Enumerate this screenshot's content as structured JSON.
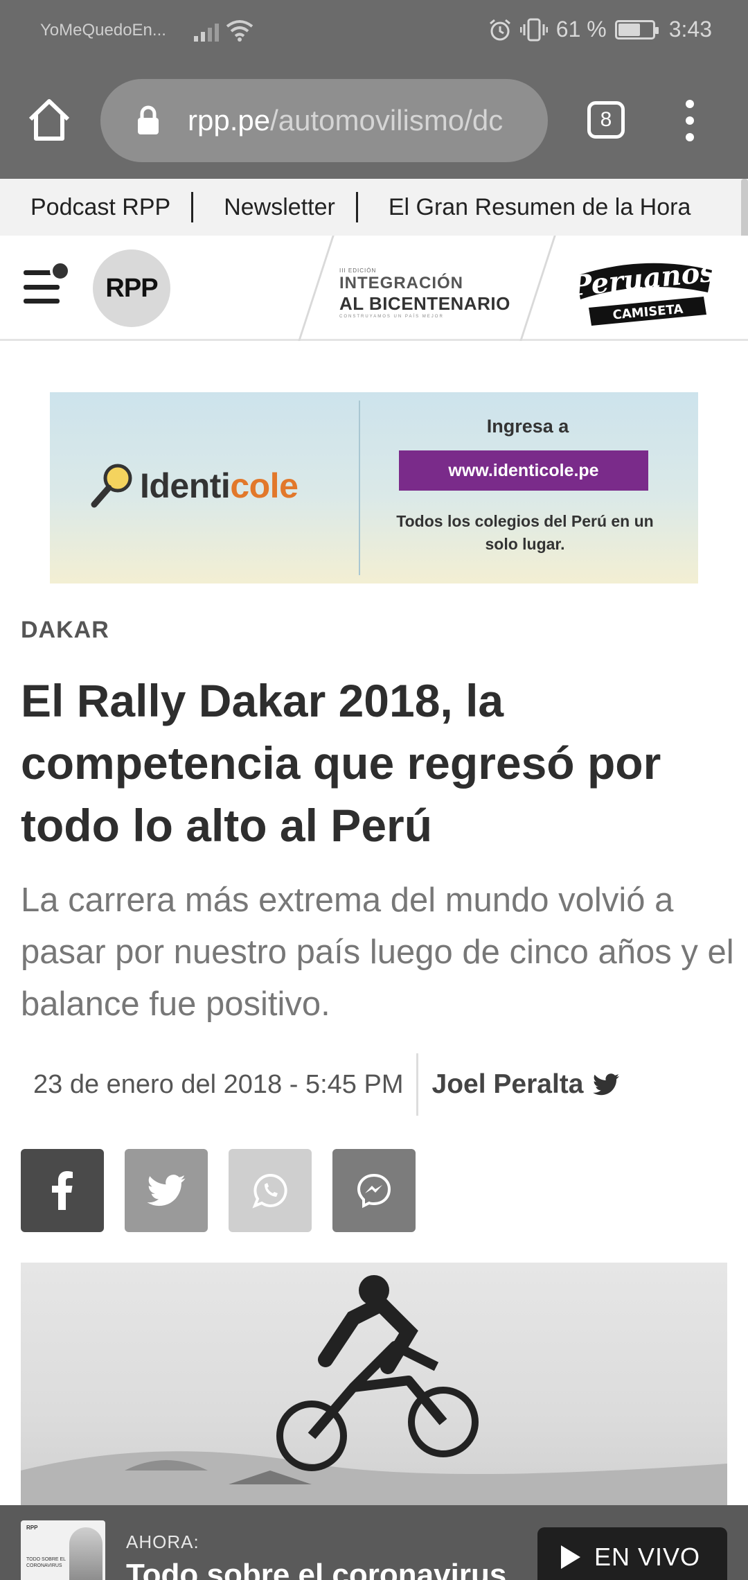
{
  "status_bar": {
    "carrier": "YoMeQuedoEn...",
    "battery": "61 %",
    "battery_level": 0.61,
    "time": "3:43"
  },
  "browser": {
    "url_domain": "rpp.pe",
    "url_path": "/automovilismo/dc",
    "tab_count": "8"
  },
  "top_links": [
    "Podcast RPP",
    "Newsletter",
    "El Gran Resumen de la Hora"
  ],
  "header": {
    "logo": "RPP",
    "bicentenario": {
      "edition": "III EDICIÓN",
      "line1": "INTEGRACIÓN",
      "line2": "AL BICENTENARIO",
      "tagline": "CONSTRUYAMOS UN PAÍS MEJOR"
    },
    "peruanos": {
      "line1": "Peruanos",
      "line2": "CAMISETA"
    }
  },
  "ad": {
    "brand_a": "Identi",
    "brand_b": "cole",
    "ingresa": "Ingresa a",
    "url": "www.identicole.pe",
    "desc": "Todos los colegios del Perú en un solo lugar."
  },
  "article": {
    "section": "DAKAR",
    "headline": "El Rally Dakar 2018, la competencia que regresó por todo lo alto al Perú",
    "subhead": "La carrera más extrema del mundo volvió a pasar por nuestro país luego de cinco años y el balance fue positivo.",
    "date": "23 de enero del 2018 - 5:45 PM",
    "author": "Joel Peralta"
  },
  "share": [
    {
      "name": "share-facebook-button",
      "icon": "facebook-icon"
    },
    {
      "name": "share-twitter-button",
      "icon": "twitter-icon"
    },
    {
      "name": "share-whatsapp-button",
      "icon": "whatsapp-icon"
    },
    {
      "name": "share-messenger-button",
      "icon": "messenger-icon"
    }
  ],
  "live": {
    "thumb_brand": "RPP",
    "thumb_text": "TODO SOBRE EL CORONAVIRUS",
    "label": "AHORA:",
    "title": "Todo sobre el coronavirus",
    "button": "EN VIVO"
  },
  "colors": {
    "chrome": "#6b6b6b",
    "ad_url_bg": "#7a2b8a",
    "ad_brand_accent": "#e2782b"
  }
}
